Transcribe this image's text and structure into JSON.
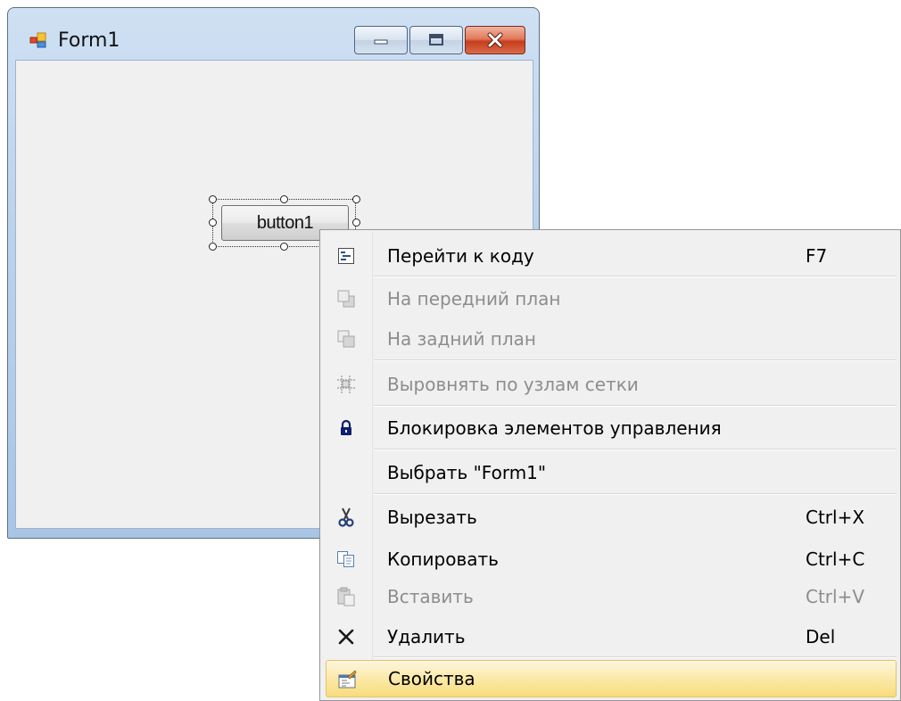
{
  "window": {
    "title": "Form1",
    "minimize": "minimize",
    "maximize": "maximize",
    "close": "close"
  },
  "designer": {
    "button_label": "button1"
  },
  "menu": {
    "items": [
      {
        "label": "Перейти к коду",
        "shortcut": "F7",
        "icon": "view-code-icon",
        "enabled": true
      },
      {
        "label": "На передний план",
        "shortcut": "",
        "icon": "bring-to-front-icon",
        "enabled": false
      },
      {
        "label": "На задний план",
        "shortcut": "",
        "icon": "send-to-back-icon",
        "enabled": false
      },
      {
        "label": "Выровнять по узлам сетки",
        "shortcut": "",
        "icon": "align-to-grid-icon",
        "enabled": false
      },
      {
        "label": "Блокировка элементов управления",
        "shortcut": "",
        "icon": "lock-icon",
        "enabled": true
      },
      {
        "label": "Выбрать \"Form1\"",
        "shortcut": "",
        "icon": "",
        "enabled": true
      },
      {
        "label": "Вырезать",
        "shortcut": "Ctrl+X",
        "icon": "cut-icon",
        "enabled": true
      },
      {
        "label": "Копировать",
        "shortcut": "Ctrl+C",
        "icon": "copy-icon",
        "enabled": true
      },
      {
        "label": "Вставить",
        "shortcut": "Ctrl+V",
        "icon": "paste-icon",
        "enabled": false
      },
      {
        "label": "Удалить",
        "shortcut": "Del",
        "icon": "delete-icon",
        "enabled": true
      },
      {
        "label": "Свойства",
        "shortcut": "",
        "icon": "properties-icon",
        "enabled": true,
        "highlighted": true
      }
    ]
  },
  "colors": {
    "highlight": "#fbe9a7",
    "disabled_text": "#8d8d8d",
    "close_button": "#c63d1b"
  }
}
